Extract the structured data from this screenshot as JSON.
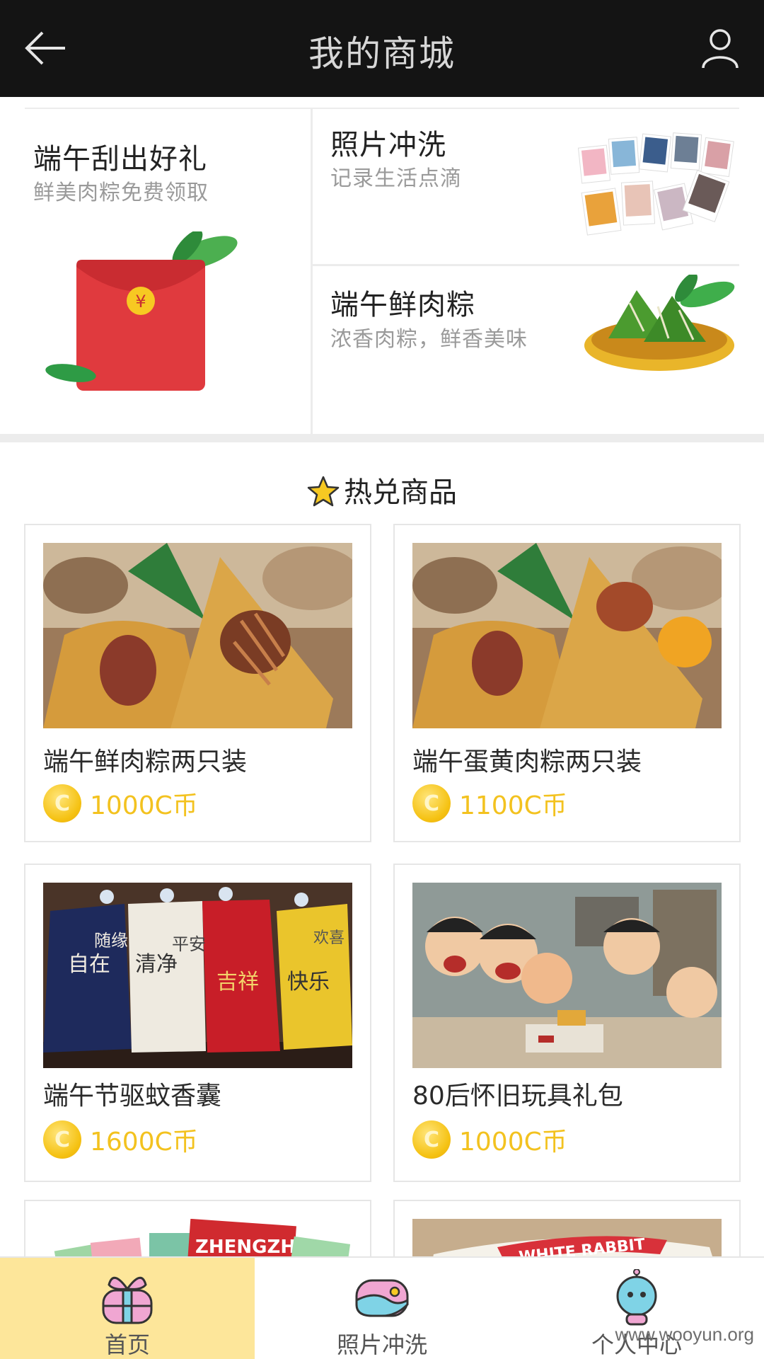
{
  "topbar": {
    "title": "我的商城"
  },
  "promo": {
    "left": {
      "title": "端午刮出好礼",
      "subtitle": "鲜美肉粽免费领取"
    },
    "right_top": {
      "title": "照片冲洗",
      "subtitle": "记录生活点滴"
    },
    "right_bottom": {
      "title": "端午鲜肉粽",
      "subtitle": "浓香肉粽，鲜香美味"
    }
  },
  "hot": {
    "title": "热兑商品",
    "products": [
      {
        "name": "端午鲜肉粽两只装",
        "price": "1000C币"
      },
      {
        "name": "端午蛋黄肉粽两只装",
        "price": "1100C币"
      },
      {
        "name": "端午节驱蚊香囊",
        "price": "1600C币"
      },
      {
        "name": "80后怀旧玩具礼包",
        "price": "1000C币"
      }
    ],
    "coin_symbol": "C",
    "sachet_labels": [
      "自在",
      "随缘",
      "清净",
      "平安",
      "吉祥",
      "快乐",
      "欢喜"
    ],
    "partial_labels": [
      "ZHENGZHU",
      "WHITE RABBIT"
    ]
  },
  "nav": {
    "items": [
      {
        "label": "首页"
      },
      {
        "label": "照片冲洗"
      },
      {
        "label": "个人中心"
      }
    ]
  },
  "watermark": "www.wooyun.org",
  "colors": {
    "topbar": "#141414",
    "accent": "#f3c21f",
    "nav_active": "#fde69a"
  }
}
